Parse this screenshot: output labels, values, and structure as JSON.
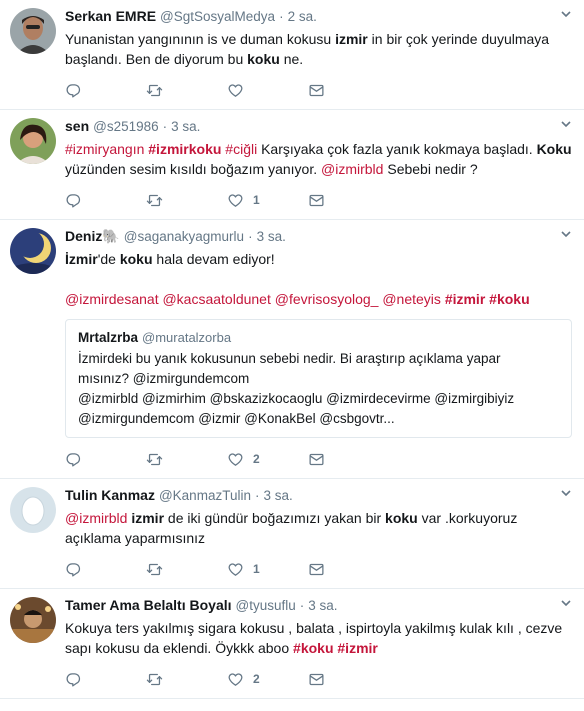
{
  "tweets": [
    {
      "name": "Serkan EMRE",
      "handle": "@SgtSosyalMedya",
      "time": "2 sa.",
      "lines": [
        [
          {
            "t": "Yunanistan yangınının is ve duman kokusu "
          },
          {
            "t": "izmir",
            "c": "kw"
          },
          {
            "t": " in bir çok yerinde duyulmaya"
          }
        ],
        [
          {
            "t": "başlandı. Ben de diyorum bu "
          },
          {
            "t": "koku",
            "c": "kw"
          },
          {
            "t": " ne."
          }
        ]
      ],
      "counts": {
        "reply": "",
        "retweet": "",
        "like": ""
      }
    },
    {
      "name": "sen",
      "handle": "@s251986",
      "time": "3 sa.",
      "lines": [
        [
          {
            "t": "#izmiryangın",
            "c": "tag"
          },
          {
            "t": " "
          },
          {
            "t": "#izmirkoku",
            "c": "tagbold"
          },
          {
            "t": " "
          },
          {
            "t": "#ciğli",
            "c": "tag"
          },
          {
            "t": " Karşıyaka çok fazla yanık kokmaya başladı. "
          },
          {
            "t": "Koku",
            "c": "kw"
          }
        ],
        [
          {
            "t": "yüzünden sesim kısıldı boğazım yanıyor. "
          },
          {
            "t": "@izmirbld",
            "c": "men"
          },
          {
            "t": "  Sebebi nedir ?"
          }
        ]
      ],
      "counts": {
        "reply": "",
        "retweet": "",
        "like": "1"
      }
    },
    {
      "name": "Deniz🐘",
      "handle": "@saganakyagmurlu",
      "time": "3 sa.",
      "lines": [
        [
          {
            "t": "İzmir",
            "c": "kw"
          },
          {
            "t": "'de "
          },
          {
            "t": "koku",
            "c": "kw"
          },
          {
            "t": " hala devam ediyor!"
          }
        ],
        [
          {
            "t": ""
          }
        ],
        [
          {
            "t": "@izmirdesanat",
            "c": "men"
          },
          {
            "t": " "
          },
          {
            "t": "@kacsaatoldunet",
            "c": "men"
          },
          {
            "t": " "
          },
          {
            "t": "@fevrisosyolog_",
            "c": "men"
          },
          {
            "t": " "
          },
          {
            "t": "@neteyis",
            "c": "men"
          },
          {
            "t": " "
          },
          {
            "t": "#izmir",
            "c": "tagbold"
          },
          {
            "t": " "
          },
          {
            "t": "#koku",
            "c": "tagbold"
          }
        ]
      ],
      "quote": {
        "name": "Mrtalzrba",
        "handle": "@muratalzorba",
        "lines": [
          "İzmirdeki bu yanık kokusunun sebebi nedir. Bi araştırıp açıklama yapar",
          "mısınız? @izmirgundemcom",
          "@izmirbld @izmirhim @bskazizkocaoglu @izmirdecevirme @izmirgibiyiz",
          "@izmirgundemcom @izmir @KonakBel @csbgovtr..."
        ]
      },
      "counts": {
        "reply": "",
        "retweet": "",
        "like": "2"
      }
    },
    {
      "name": "Tulin Kanmaz",
      "handle": "@KanmazTulin",
      "time": "3 sa.",
      "lines": [
        [
          {
            "t": "@izmirbld",
            "c": "men"
          },
          {
            "t": " "
          },
          {
            "t": "izmir",
            "c": "kw"
          },
          {
            "t": " de iki gündür boğazımızı yakan bir "
          },
          {
            "t": "koku",
            "c": "kw"
          },
          {
            "t": " var .korkuyoruz"
          }
        ],
        [
          {
            "t": "açıklama yaparmısınız"
          }
        ]
      ],
      "counts": {
        "reply": "",
        "retweet": "",
        "like": "1"
      }
    },
    {
      "name": "Tamer Ama Belaltı Boyalı",
      "handle": "@tyusuflu",
      "time": "3 sa.",
      "lines": [
        [
          {
            "t": "Kokuya ters yakılmış sigara kokusu , balata , ispirtoyla yakilmış kulak kılı , cezve"
          }
        ],
        [
          {
            "t": "sapı kokusu da eklendi. Öykkk aboo "
          },
          {
            "t": "#koku",
            "c": "tagbold"
          },
          {
            "t": " "
          },
          {
            "t": "#izmir",
            "c": "tagbold"
          }
        ]
      ],
      "counts": {
        "reply": "",
        "retweet": "",
        "like": "2"
      }
    }
  ],
  "separator": "·",
  "caret_icon": "chevron-down-icon",
  "colors": {
    "accent": "#c4163b",
    "muted": "#657786",
    "border": "#e6ecf0"
  }
}
